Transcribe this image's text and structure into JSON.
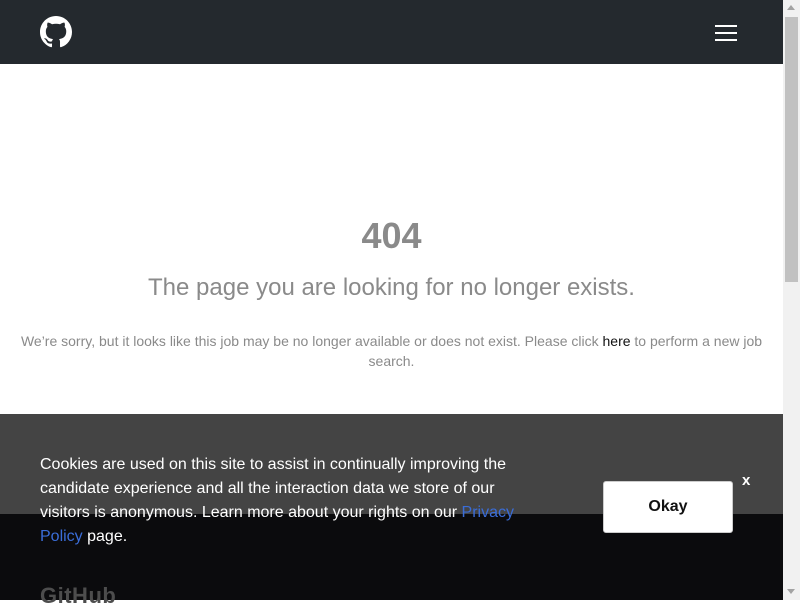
{
  "header": {
    "logo_icon": "github-icon",
    "menu_icon": "hamburger-menu-icon"
  },
  "error": {
    "code": "404",
    "title": "The page you are looking for no longer exists.",
    "text_before": "We’re sorry, but it looks like this job may be no longer available or does not exist. Please click ",
    "link_label": "here",
    "text_after": " to perform a new job search."
  },
  "cookie_banner": {
    "text_before": "Cookies are used on this site to assist in continually improving the candidate experience and all the interaction data we store of our visitors is anonymous. Learn more about your rights on our ",
    "link_label": "Privacy Policy",
    "text_after": " page.",
    "okay_label": "Okay",
    "close_label": "x"
  },
  "footer": {
    "brand": "GitHub"
  },
  "colors": {
    "header_bg": "#24292e",
    "muted_text": "#8a8a8a",
    "footer_grey": "#444444",
    "footer_dark": "#0b0b0d",
    "link_blue": "#3a6dd8"
  }
}
